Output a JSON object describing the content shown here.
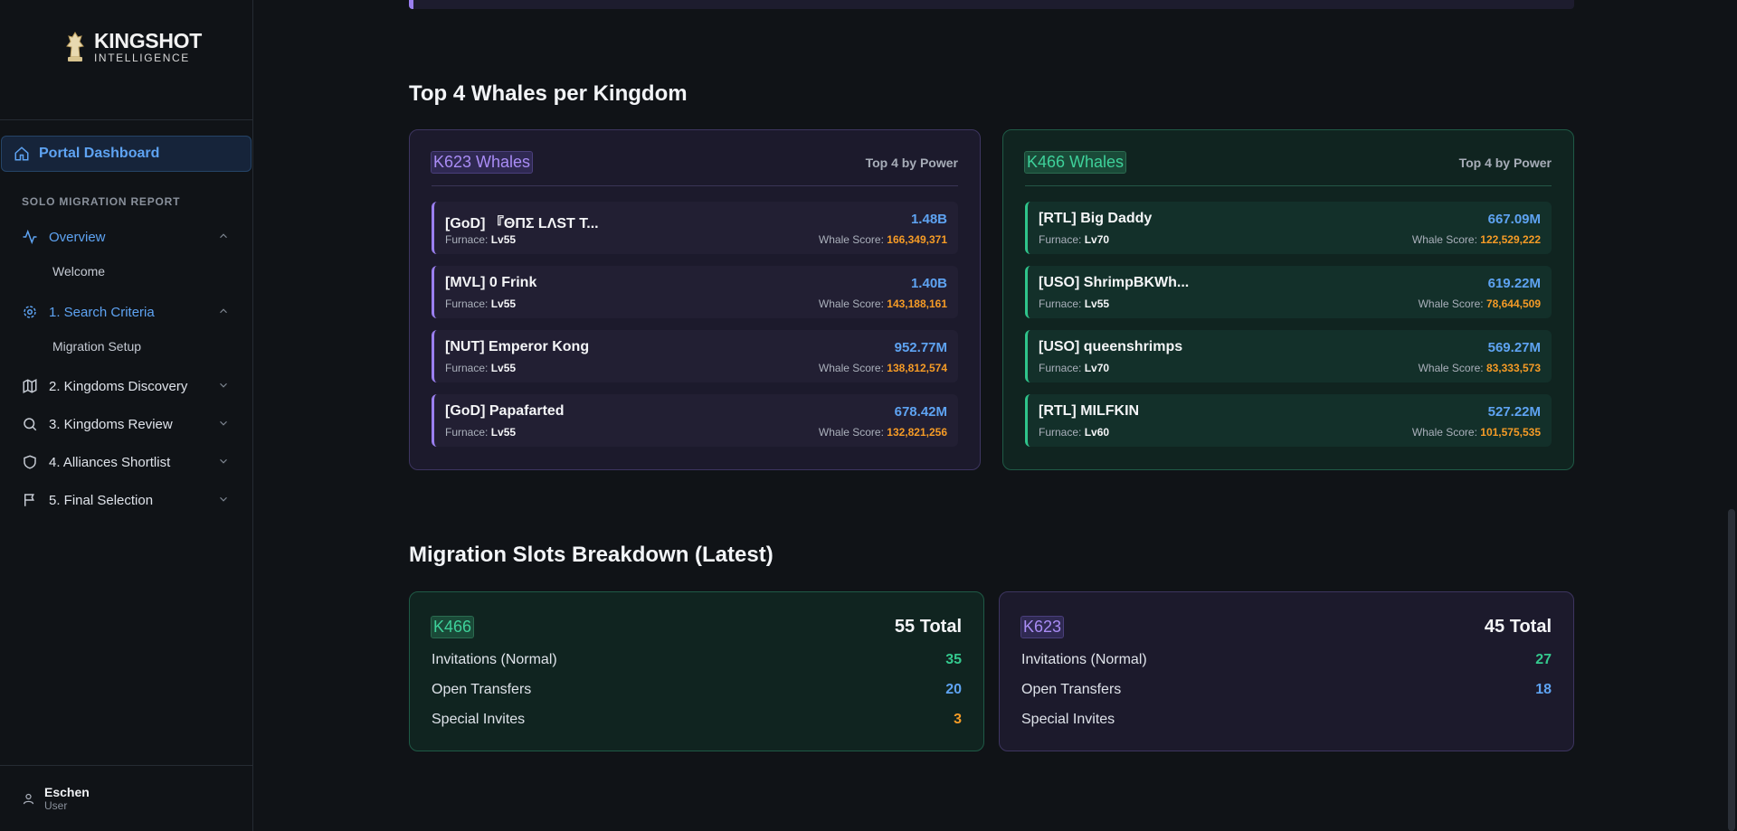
{
  "brand": {
    "title": "KINGSHOT",
    "subtitle": "INTELLIGENCE"
  },
  "sidebar": {
    "dashboard": "Portal Dashboard",
    "section": "SOLO MIGRATION REPORT",
    "items": [
      {
        "label": "Overview",
        "sub": "Welcome"
      },
      {
        "label": "1. Search Criteria",
        "sub": "Migration Setup"
      },
      {
        "label": "2. Kingdoms Discovery"
      },
      {
        "label": "3. Kingdoms Review"
      },
      {
        "label": "4. Alliances Shortlist"
      },
      {
        "label": "5. Final Selection"
      }
    ],
    "user": {
      "name": "Eschen",
      "role": "User"
    }
  },
  "whales_section": {
    "title": "Top 4 Whales per Kingdom",
    "cards": [
      {
        "kingdom": "K623 Whales",
        "subtitle": "Top 4 by Power",
        "color": "#9b7ff0",
        "rows": [
          {
            "name": "[GoD] 『ΘΠΣ LΛST T...",
            "furnace_label": "Furnace:",
            "furnace": "Lv55",
            "power": "1.48B",
            "score_label": "Whale Score:",
            "score": "166,349,371"
          },
          {
            "name": "[MVL] 0 Frink",
            "furnace_label": "Furnace:",
            "furnace": "Lv55",
            "power": "1.40B",
            "score_label": "Whale Score:",
            "score": "143,188,161"
          },
          {
            "name": "[NUT] Emperor Kong",
            "furnace_label": "Furnace:",
            "furnace": "Lv55",
            "power": "952.77M",
            "score_label": "Whale Score:",
            "score": "138,812,574"
          },
          {
            "name": "[GoD] Papafarted",
            "furnace_label": "Furnace:",
            "furnace": "Lv55",
            "power": "678.42M",
            "score_label": "Whale Score:",
            "score": "132,821,256"
          }
        ]
      },
      {
        "kingdom": "K466 Whales",
        "subtitle": "Top 4 by Power",
        "color": "#2fc48b",
        "rows": [
          {
            "name": "[RTL] Big Daddy",
            "furnace_label": "Furnace:",
            "furnace": "Lv70",
            "power": "667.09M",
            "score_label": "Whale Score:",
            "score": "122,529,222"
          },
          {
            "name": "[USO] ShrimpBKWh...",
            "furnace_label": "Furnace:",
            "furnace": "Lv55",
            "power": "619.22M",
            "score_label": "Whale Score:",
            "score": "78,644,509"
          },
          {
            "name": "[USO] queenshrimps",
            "furnace_label": "Furnace:",
            "furnace": "Lv70",
            "power": "569.27M",
            "score_label": "Whale Score:",
            "score": "83,333,573"
          },
          {
            "name": "[RTL] MILFKIN",
            "furnace_label": "Furnace:",
            "furnace": "Lv60",
            "power": "527.22M",
            "score_label": "Whale Score:",
            "score": "101,575,535"
          }
        ]
      }
    ]
  },
  "slots_section": {
    "title": "Migration Slots Breakdown (Latest)",
    "cards": [
      {
        "kingdom": "K466",
        "total": "55 Total",
        "rows": [
          {
            "label": "Invitations (Normal)",
            "value": "35"
          },
          {
            "label": "Open Transfers",
            "value": "20"
          },
          {
            "label": "Special Invites",
            "value": "3"
          }
        ]
      },
      {
        "kingdom": "K623",
        "total": "45 Total",
        "rows": [
          {
            "label": "Invitations (Normal)",
            "value": "27"
          },
          {
            "label": "Open Transfers",
            "value": "18"
          },
          {
            "label": "Special Invites",
            "value": ""
          }
        ]
      }
    ]
  }
}
